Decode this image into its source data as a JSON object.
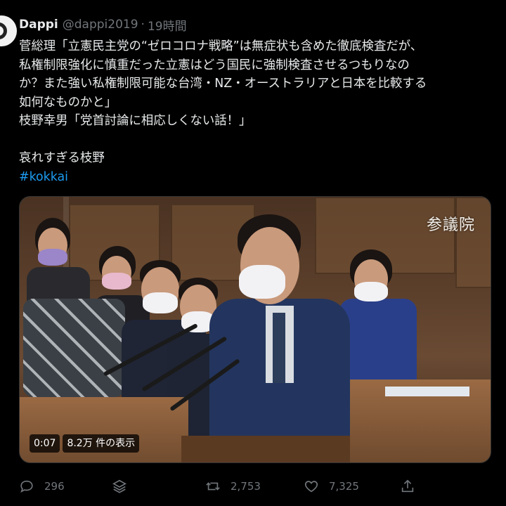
{
  "tweet": {
    "display_name": "Dappi",
    "handle": "@dappi2019",
    "separator": "·",
    "time": "19時間",
    "lines": [
      "菅総理「立憲民主党の“ゼロコロナ戦略”は無症状も含めた徹底検査だが、",
      "私権制限強化に慎重だった立憲はどう国民に強制検査させるつもりなの",
      "か？また強い私権制限可能な台湾・NZ・オーストラリアと日本を比較する",
      "如何なものかと」",
      "枝野幸男「党首討論に相応しくない話！」"
    ],
    "comment": "哀れすぎる枝野",
    "hashtag": "#kokkai"
  },
  "media": {
    "watermark": "参議院",
    "duration": "0:07",
    "views": "8.2万 件の表示"
  },
  "actions": {
    "reply_count": "296",
    "retweet_count": "2,753",
    "like_count": "7,325"
  },
  "colors": {
    "background": "#000000",
    "text": "#e7e9ea",
    "muted": "#71767b",
    "link": "#1d9bf0"
  }
}
